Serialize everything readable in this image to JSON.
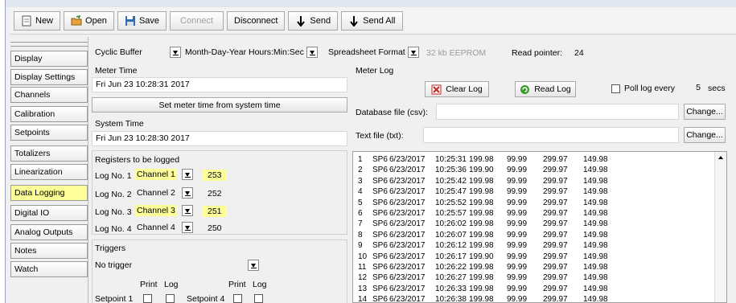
{
  "toolbar": {
    "new_label": "New",
    "open_label": "Open",
    "save_label": "Save",
    "connect_label": "Connect",
    "disconnect_label": "Disconnect",
    "send_label": "Send",
    "send_all_label": "Send All"
  },
  "nav": {
    "items": [
      {
        "label": "Display"
      },
      {
        "label": "Display Settings"
      },
      {
        "label": "Channels"
      },
      {
        "label": "Calibration"
      },
      {
        "label": "Setpoints"
      },
      {
        "label": "Totalizers"
      },
      {
        "label": "Linearization"
      },
      {
        "label": "Data Logging",
        "active": true
      },
      {
        "label": "Digital IO"
      },
      {
        "label": "Analog Outputs"
      },
      {
        "label": "Notes"
      },
      {
        "label": "Watch"
      }
    ]
  },
  "top_options": {
    "buffer_mode": "Cyclic Buffer",
    "date_format": "Month-Day-Year Hours:Min:Sec",
    "file_format": "Spreadsheet Format",
    "memory_label": "32 kb EEPROM",
    "read_pointer_label": "Read pointer:",
    "read_pointer_value": "24"
  },
  "meter_time": {
    "heading": "Meter Time",
    "value": "Fri Jun 23 10:28:31 2017",
    "set_button": "Set meter time from system time"
  },
  "system_time": {
    "heading": "System Time",
    "value": "Fri Jun 23 10:28:30 2017"
  },
  "registers": {
    "heading": "Registers to be logged",
    "rows": [
      {
        "label": "Log No. 1",
        "channel": "Channel 1",
        "value": "253",
        "highlight": true
      },
      {
        "label": "Log No. 2",
        "channel": "Channel 2",
        "value": "252",
        "highlight": false
      },
      {
        "label": "Log No. 3",
        "channel": "Channel 3",
        "value": "251",
        "highlight": true
      },
      {
        "label": "Log No. 4",
        "channel": "Channel 4",
        "value": "250",
        "highlight": false
      }
    ]
  },
  "triggers": {
    "heading": "Triggers",
    "selected": "No trigger",
    "print_label": "Print",
    "log_label": "Log",
    "setpoint1_label": "Setpoint 1",
    "setpoint4_label": "Setpoint 4"
  },
  "meter_log": {
    "heading": "Meter Log",
    "clear_label": "Clear Log",
    "read_label": "Read Log",
    "poll_label": "Poll log every",
    "poll_value": "5",
    "poll_unit": "secs",
    "db_file_label": "Database file (csv):",
    "text_file_label": "Text file (txt):",
    "change_label": "Change..."
  },
  "log_rows": [
    [
      "1",
      "SP6",
      "6/23/2017",
      "10:25:31",
      "199.98",
      "99.99",
      "299.97",
      "149.98"
    ],
    [
      "2",
      "SP6",
      "6/23/2017",
      "10:25:36",
      "199.90",
      "99.99",
      "299.97",
      "149.98"
    ],
    [
      "3",
      "SP6",
      "6/23/2017",
      "10:25:42",
      "199.98",
      "99.99",
      "299.97",
      "149.98"
    ],
    [
      "4",
      "SP6",
      "6/23/2017",
      "10:25:47",
      "199.98",
      "99.99",
      "299.97",
      "149.98"
    ],
    [
      "5",
      "SP6",
      "6/23/2017",
      "10:25:52",
      "199.98",
      "99.99",
      "299.97",
      "149.98"
    ],
    [
      "6",
      "SP6",
      "6/23/2017",
      "10:25:57",
      "199.98",
      "99.99",
      "299.97",
      "149.98"
    ],
    [
      "7",
      "SP6",
      "6/23/2017",
      "10:26:02",
      "199.98",
      "99.99",
      "299.97",
      "149.98"
    ],
    [
      "8",
      "SP6",
      "6/23/2017",
      "10:26:07",
      "199.98",
      "99.99",
      "299.97",
      "149.98"
    ],
    [
      "9",
      "SP6",
      "6/23/2017",
      "10:26:12",
      "199.98",
      "99.99",
      "299.97",
      "149.98"
    ],
    [
      "10",
      "SP6",
      "6/23/2017",
      "10:26:17",
      "199.90",
      "99.99",
      "299.97",
      "149.98"
    ],
    [
      "11",
      "SP6",
      "6/23/2017",
      "10:26:22",
      "199.98",
      "99.99",
      "299.97",
      "149.98"
    ],
    [
      "12",
      "SP6",
      "6/23/2017",
      "10:26:27",
      "199.98",
      "99.99",
      "299.97",
      "149.98"
    ],
    [
      "13",
      "SP6",
      "6/23/2017",
      "10:26:33",
      "199.98",
      "99.99",
      "299.97",
      "149.98"
    ],
    [
      "14",
      "SP6",
      "6/23/2017",
      "10:26:38",
      "199.98",
      "99.99",
      "299.97",
      "149.98"
    ]
  ],
  "colors": {
    "highlight": "#ffff99",
    "app_bg": "#f0f0f0",
    "open_icon": "#e8a33a",
    "save_icon": "#2f6db5",
    "clear_icon": "#cc2222",
    "read_icon": "#3a9a2a"
  }
}
